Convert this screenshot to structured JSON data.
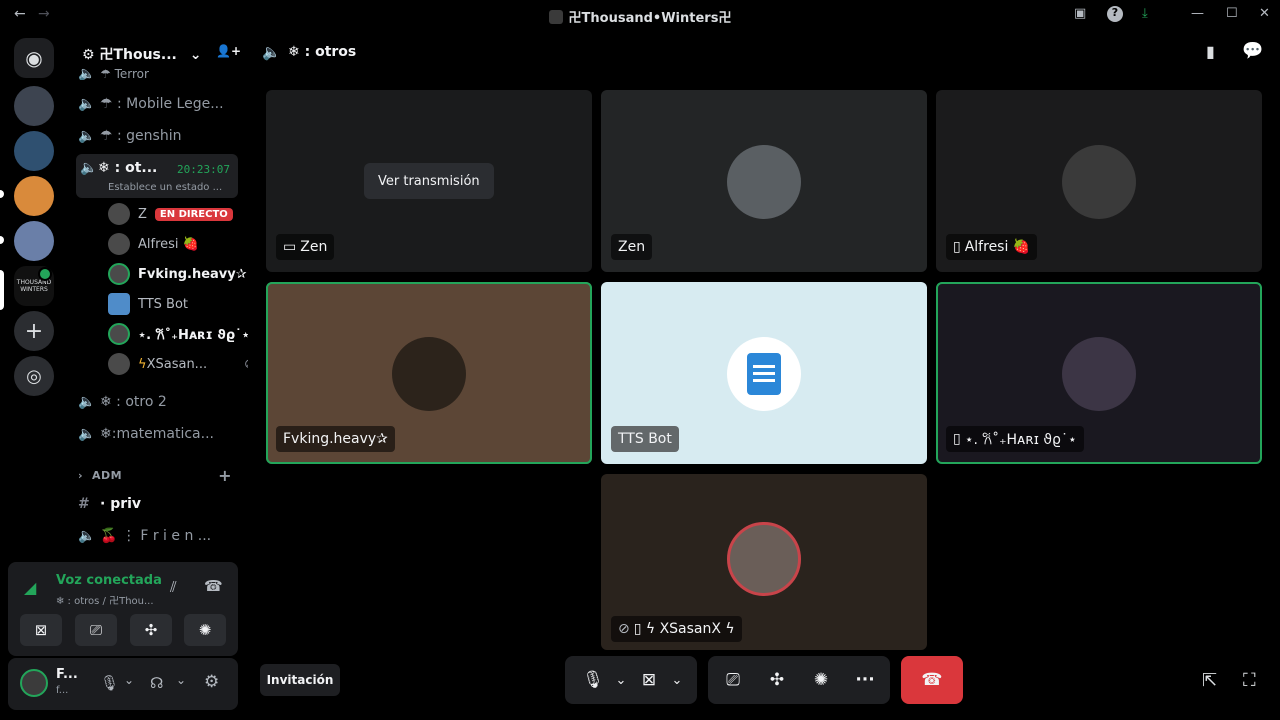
{
  "titlebar": {
    "title": "卍Thousand•Winters卍",
    "back": "←",
    "forward": "→",
    "inbox": "▣",
    "help": "?",
    "download": "⤓",
    "minimize": "—",
    "maximize": "☐",
    "close": "✕"
  },
  "servers": {
    "home_glyph": "◉",
    "add_glyph": "+",
    "discover_glyph": "◎",
    "tw_label": "THOUSAND WINTERS"
  },
  "guild": {
    "name": "卍Thous...",
    "chevron": "⌄",
    "invite_glyph": "👤+"
  },
  "channels": {
    "partial_top": "☂ Terror",
    "ch1": "☂ : Mobile Lege...",
    "ch2": "☂ : genshin",
    "active_name": "❄ : ot...",
    "active_time": "20:23:07",
    "active_status": "Establece un estado ...",
    "ch3": "❄ : otro 2",
    "ch4": "❄:matematica...",
    "category": "ADM",
    "category_add": "+",
    "priv": "· priv",
    "friends": "🍒 ⋮ F r i e n ..."
  },
  "members": [
    {
      "name": "Z",
      "badge": "EN DIRECTO"
    },
    {
      "name": "Alfresi 🍓"
    },
    {
      "name": "Fvking.heavy✰"
    },
    {
      "name": "TTS Bot"
    },
    {
      "name": "⋆. 𐙚˚₊Hᴀʀɪ ϑϱ˙⋆"
    },
    {
      "name": "XSasan..."
    }
  ],
  "voice": {
    "status": "Voz conectada",
    "location": "❄ : otros / 卍Thou..."
  },
  "user": {
    "name": "F...",
    "sub": "f..."
  },
  "header": {
    "channel": "❄ : otros"
  },
  "tiles": [
    {
      "label": "Zen",
      "overlay": "Ver transmisión",
      "prefix": "▭"
    },
    {
      "label": "Zen"
    },
    {
      "label": "Alfresi 🍓",
      "prefix": "▯"
    },
    {
      "label": "Fvking.heavy✰"
    },
    {
      "label": "TTS Bot"
    },
    {
      "label": "⋆. 𐙚˚₊Hᴀʀɪ ϑϱ˙⋆",
      "prefix": "▯"
    },
    {
      "label": "▯ ϟ XSasanX ϟ"
    }
  ],
  "controls": {
    "invite": "Invitación",
    "more": "···"
  },
  "colors": {
    "speaking": "#23a55a",
    "live": "#da373c",
    "hangup": "#da373c",
    "voice_ok": "#23a55a"
  }
}
